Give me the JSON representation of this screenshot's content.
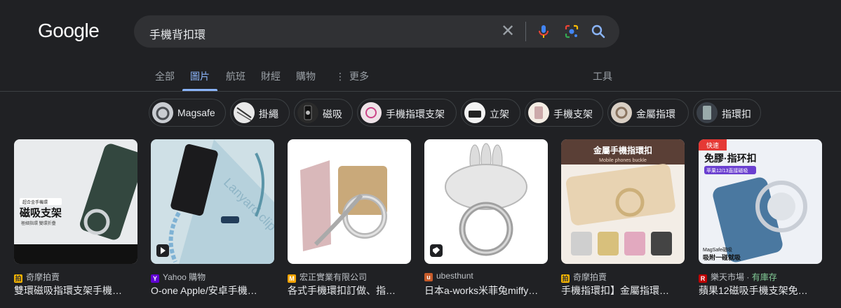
{
  "logo": "Google",
  "search": {
    "query": "手機背扣環"
  },
  "tabs": [
    "全部",
    "圖片",
    "航班",
    "財經",
    "購物",
    "更多",
    "工具"
  ],
  "chips": [
    "Magsafe",
    "掛繩",
    "磁吸",
    "手機指環支架",
    "立架",
    "手機支架",
    "金屬指環",
    "指環扣"
  ],
  "results": [
    {
      "source": "奇摩拍賣",
      "title": "雙環磁吸指環支架手機…",
      "overlay1": "超合金手機環",
      "overlay2": "磁吸支架",
      "overlay3": "極細指環 雙環折疊"
    },
    {
      "source": "Yahoo 購物",
      "title": "O-one Apple/安卓手機…",
      "overlay1": "Lanyard clip"
    },
    {
      "source": "宏正實業有限公司",
      "title": "各式手機環扣訂做、指…"
    },
    {
      "source": "ubesthunt",
      "title": "日本a-works米菲兔miffy…"
    },
    {
      "source": "奇摩拍賣",
      "title": "手機指環扣】金屬指環…",
      "overlay1": "金屬手機指環扣",
      "overlay2": "Mobile phones buckle"
    },
    {
      "source": "樂天市場",
      "source_extra": "有庫存",
      "title": "蘋果12磁吸手機支架免…",
      "overlay1": "快速",
      "overlay2": "免膠·指环扣",
      "overlay3": "苹果12/13直接磁吸",
      "overlay4": "MagSafe磁吸",
      "overlay5": "吸附一碰就吸"
    }
  ],
  "colors": {
    "accent": "#8ab4f8",
    "bg": "#202124",
    "in_stock": "#81c995"
  }
}
